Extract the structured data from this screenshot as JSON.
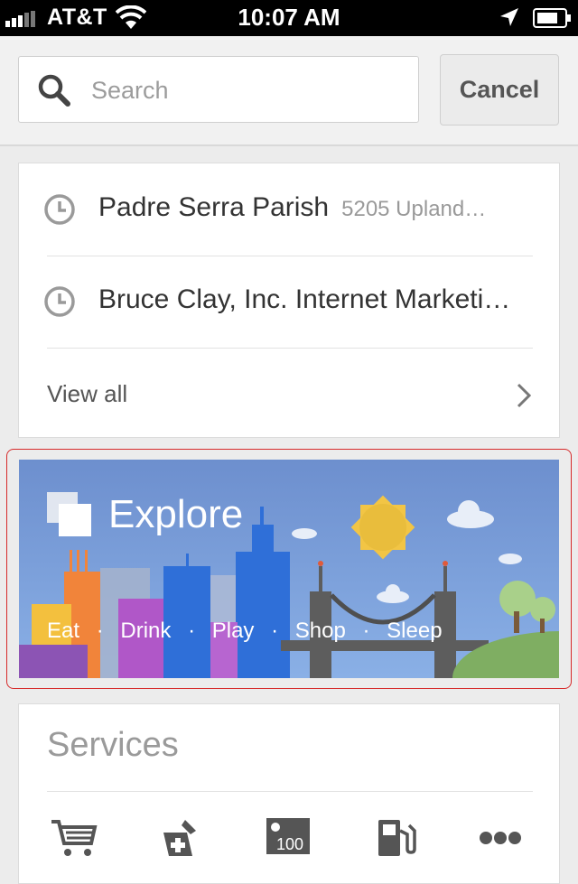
{
  "status_bar": {
    "carrier": "AT&T",
    "time": "10:07 AM"
  },
  "search": {
    "placeholder": "Search",
    "value": "",
    "cancel_label": "Cancel"
  },
  "recents": {
    "items": [
      {
        "name": "Padre Serra Parish",
        "address": "5205 Upland…"
      },
      {
        "name": "Bruce Clay, Inc. Internet Marketi…",
        "address": ""
      }
    ],
    "view_all_label": "View all"
  },
  "explore": {
    "title": "Explore",
    "tags": [
      "Eat",
      "Drink",
      "Play",
      "Shop",
      "Sleep"
    ],
    "separator": "·"
  },
  "services": {
    "heading": "Services",
    "icons": [
      "shopping-cart-icon",
      "pharmacy-icon",
      "atm-icon",
      "gas-station-icon",
      "more-icon"
    ]
  }
}
